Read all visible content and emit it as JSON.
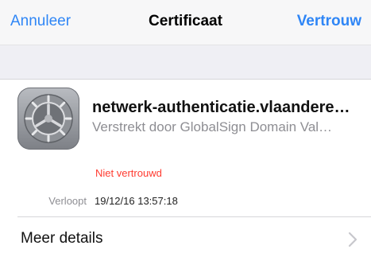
{
  "navbar": {
    "cancel_label": "Annuleer",
    "title": "Certificaat",
    "trust_label": "Vertrouw"
  },
  "certificate": {
    "icon": "settings-gear-icon",
    "name": "netwerk-authenticatie.vlaandere…",
    "issuer": "Verstrekt door GlobalSign Domain Val…",
    "status": "Niet vertrouwd",
    "expires_label": "Verloopt",
    "expires_value": "19/12/16 13:57:18"
  },
  "details": {
    "label": "Meer details",
    "icon": "chevron-right-icon"
  },
  "colors": {
    "accent": "#2f86f6",
    "warning": "#ff3b30",
    "secondary_text": "#8e8e93"
  }
}
